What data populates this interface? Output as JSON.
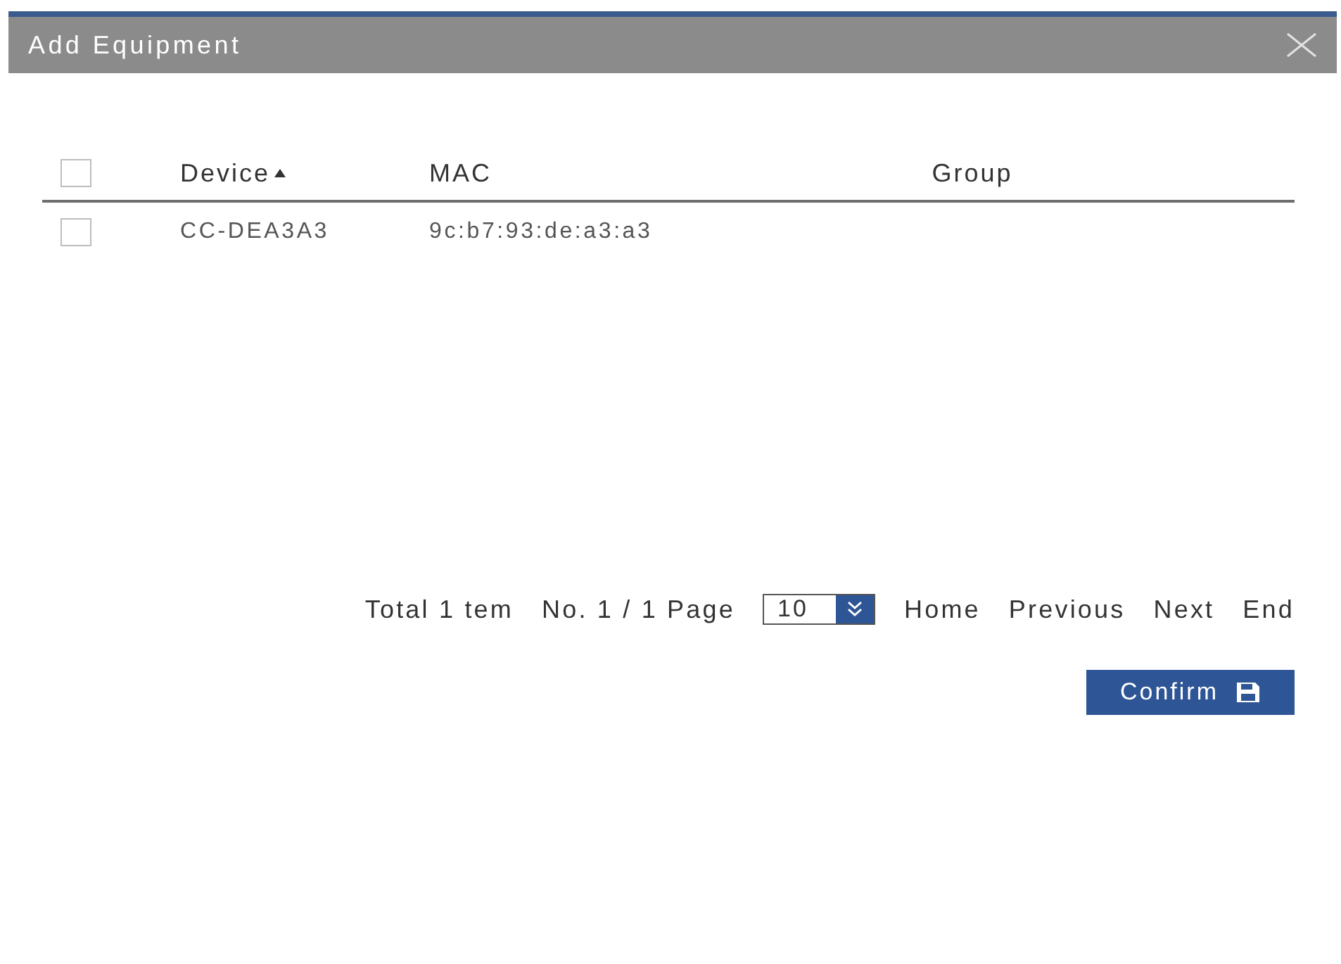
{
  "dialog": {
    "title": "Add Equipment"
  },
  "table": {
    "select_all": {
      "checked": false
    },
    "columns": [
      {
        "label": "Device",
        "sorted": true,
        "ascending": true
      },
      {
        "label": "MAC",
        "sorted": false
      },
      {
        "label": "Group",
        "sorted": false
      }
    ],
    "rows": [
      {
        "checked": false,
        "device": "CC-DEA3A3",
        "mac": "9c:b7:93:de:a3:a3"
      }
    ]
  },
  "pagination": {
    "total": "Total 1 tem",
    "page": "No. 1 / 1 Page",
    "page_size": "10",
    "links": [
      "Home",
      "Previous",
      "Next",
      "End"
    ]
  },
  "confirm_button": {
    "label": "Confirm"
  }
}
